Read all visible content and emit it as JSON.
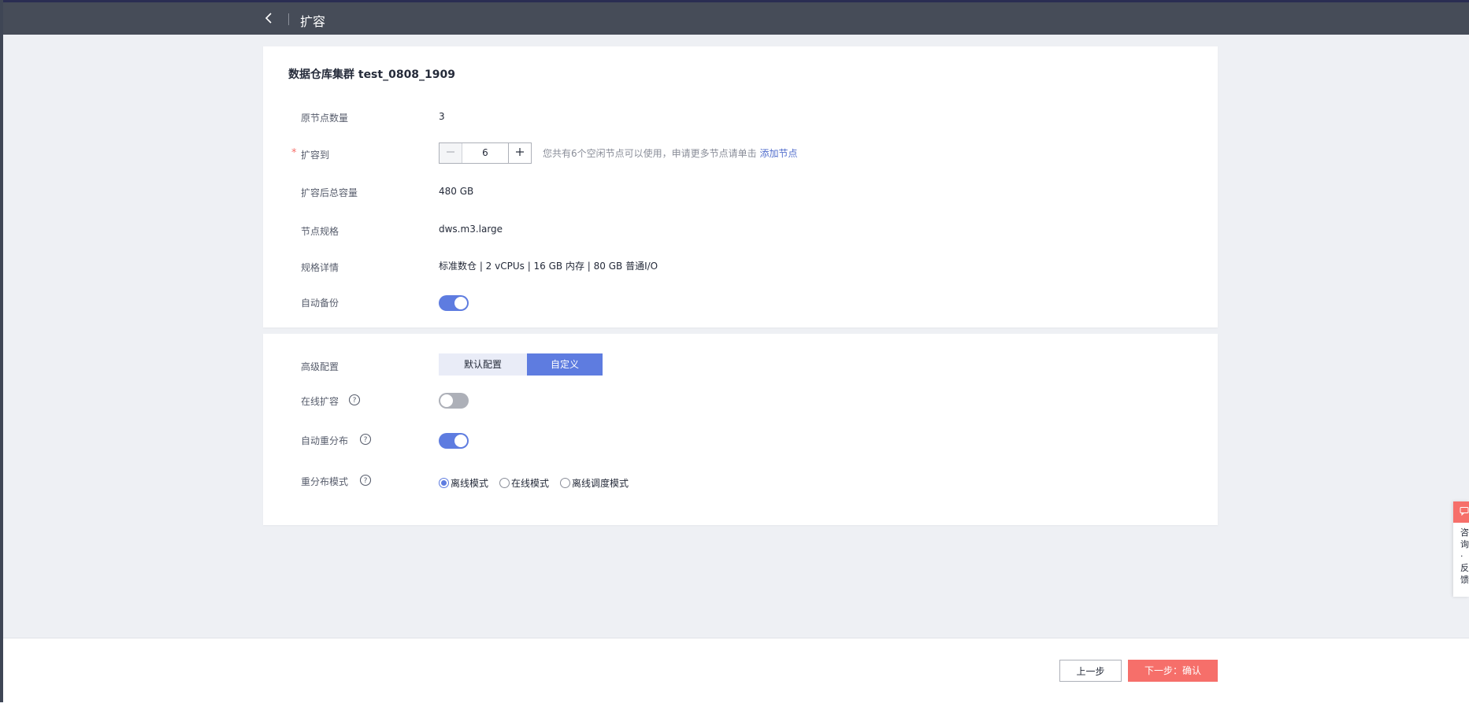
{
  "header": {
    "title": "扩容"
  },
  "cluster": {
    "title": "数据仓库集群 test_0808_1909"
  },
  "form": {
    "original_nodes_label": "原节点数量",
    "original_nodes_value": "3",
    "expand_to_label": "扩容到",
    "required_mark": "*",
    "expand_to_value": "6",
    "hint_text": "您共有6个空闲节点可以使用，申请更多节点请单击 ",
    "hint_link": "添加节点",
    "total_capacity_label": "扩容后总容量",
    "total_capacity_value": "480 GB",
    "node_flavor_label": "节点规格",
    "node_flavor_value": "dws.m3.large",
    "flavor_detail_label": "规格详情",
    "flavor_detail_value": "标准数仓 | 2 vCPUs | 16 GB 内存 | 80 GB 普通I/O",
    "auto_backup_label": "自动备份",
    "auto_backup_on": true
  },
  "advanced": {
    "label": "高级配置",
    "options": [
      "默认配置",
      "自定义"
    ],
    "selected": "自定义",
    "online_expand_label": "在线扩容",
    "online_expand_on": false,
    "auto_redistribute_label": "自动重分布",
    "auto_redistribute_on": true,
    "redistribute_mode_label": "重分布模式",
    "redistribute_modes": [
      "离线模式",
      "在线模式",
      "离线调度模式"
    ],
    "redistribute_mode_selected": "离线模式"
  },
  "footer": {
    "prev_label": "上一步",
    "next_label": "下一步：确认"
  },
  "float_widget": {
    "text": "咨\n询\n·\n反\n馈"
  },
  "colors": {
    "topbar": "#464c58",
    "brand": "#5e7ce0",
    "danger": "#f66f6a",
    "background": "#eef0f4"
  },
  "icons": {
    "back": "chevron-left-icon",
    "help": "question-circle-icon",
    "minus": "minus-icon",
    "plus": "plus-icon",
    "feedback": "chat-icon"
  }
}
